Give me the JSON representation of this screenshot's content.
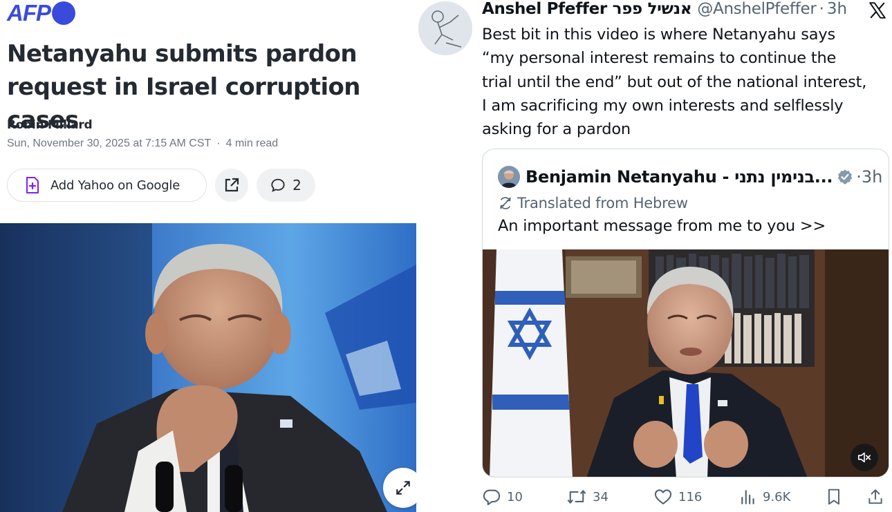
{
  "article": {
    "source_logo": "AFP",
    "headline_line1": "Netanyahu submits pardon",
    "headline_line2": "request in Israel corruption cases",
    "author": "Robin Millard",
    "date": "Sun, November 30, 2025 at 7:15 AM CST",
    "separator": "·",
    "read_time": "4 min read",
    "add_google_label": "Add Yahoo on Google",
    "comment_count": "2",
    "image_icons": [
      "share-external-icon",
      "comment-icon",
      "expand-icon"
    ]
  },
  "tweet": {
    "display_name": "Anshel Pfeffer אנשיל פפר",
    "handle": "@AnshelPfeffer",
    "dot": "·",
    "time": "3h",
    "body_lines": [
      "Best bit in this video is where Netanyahu says",
      "“my personal interest remains to continue the",
      "trial until the end” but out of the national interest,",
      "I am sacrificing my own interests and selflessly",
      "asking for a pardon"
    ],
    "quote": {
      "display_name": "Benjamin Netanyahu - בנימין נתני...",
      "dot": "·",
      "time": "3h",
      "translated_label": "Translated from Hebrew",
      "text": "An important message from me to you >>"
    },
    "actions": {
      "replies": "10",
      "reposts": "34",
      "likes": "116",
      "views": "9.6K"
    }
  },
  "colors": {
    "afp_blue": "#3a4bdc",
    "yahoo_purple": "#7e1fff",
    "x_text": "#0f1419",
    "x_secondary": "#536471",
    "verified_gray": "#829aab"
  }
}
